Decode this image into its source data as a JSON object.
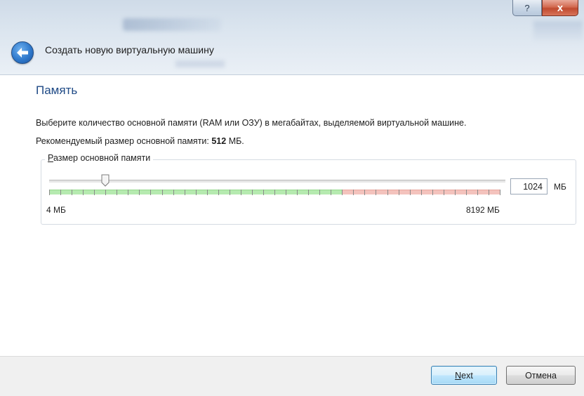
{
  "window": {
    "help_label": "?",
    "close_label": "x",
    "title": "Создать новую виртуальную машину"
  },
  "page": {
    "heading": "Память",
    "description": "Выберите количество основной памяти (RAM или ОЗУ) в мегабайтах, выделяемой виртуальной машине.",
    "recommended_prefix": "Рекомендуемый размер основной памяти: ",
    "recommended_value": "512",
    "recommended_suffix": " МБ."
  },
  "memory": {
    "group_label_accel": "Р",
    "group_label_rest": "азмер основной памяти",
    "value": "1024",
    "unit": "МБ",
    "min_label": "4 МБ",
    "max_label": "8192 МБ",
    "slider_min": 4,
    "slider_max": 8192,
    "slider_value": 1024,
    "recommended_max_fraction": 0.65
  },
  "footer": {
    "next_accel": "N",
    "next_rest": "ext",
    "cancel_label": "Отмена"
  },
  "colors": {
    "heading": "#1f4a86",
    "scale_green": "#b6eab0",
    "scale_red": "#f4c3bd"
  },
  "icons": {
    "back": "back-arrow-icon",
    "help": "help-icon",
    "close": "close-icon"
  }
}
